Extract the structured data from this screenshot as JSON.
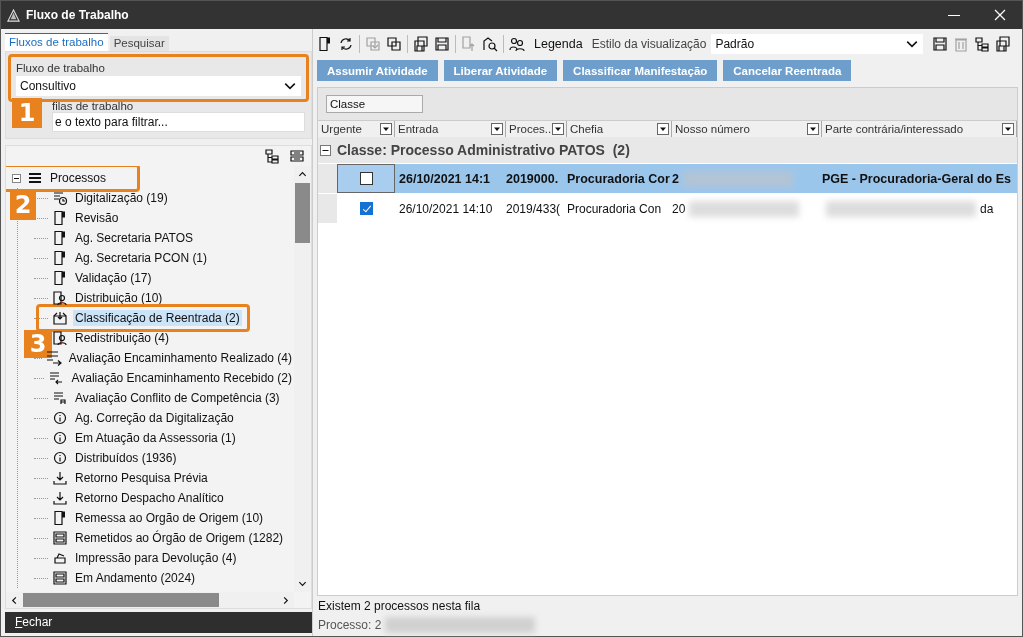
{
  "window": {
    "title": "Fluxo de Trabalho"
  },
  "left_tabs": [
    {
      "label": "Fluxos de trabalho",
      "selected": true
    },
    {
      "label": "Pesquisar",
      "selected": false
    }
  ],
  "workflow": {
    "label": "Fluxo de trabalho",
    "value": "Consultivo"
  },
  "queue_filter": {
    "label": "filas de trabalho",
    "value": "e o texto para filtrar..."
  },
  "tree": [
    {
      "label": "Processos",
      "kind": "stack",
      "expanded": true,
      "selected": false,
      "children": [
        {
          "label": "Digitalização (19)",
          "kind": "clock",
          "selected": false
        },
        {
          "label": "Revisão",
          "kind": "doc",
          "selected": false
        },
        {
          "label": "Ag. Secretaria PATOS",
          "kind": "doc",
          "selected": false
        },
        {
          "label": "Ag. Secretaria PCON (1)",
          "kind": "doc",
          "selected": false
        },
        {
          "label": "Validação (17)",
          "kind": "doc",
          "selected": false
        },
        {
          "label": "Distribuição (10)",
          "kind": "person",
          "selected": false
        },
        {
          "label": "Classificação de Reentrada (2)",
          "kind": "inbox",
          "selected": true
        },
        {
          "label": "Redistribuição (4)",
          "kind": "person",
          "selected": false
        },
        {
          "label": "Avaliação Encaminhamento Realizado (4)",
          "kind": "list-out",
          "selected": false
        },
        {
          "label": "Avaliação Encaminhamento Recebido (2)",
          "kind": "list-in",
          "selected": false
        },
        {
          "label": "Avaliação Conflito de Competência (3)",
          "kind": "list-a",
          "selected": false
        },
        {
          "label": "Ag. Correção da Digitalização",
          "kind": "info",
          "selected": false
        },
        {
          "label": "Em Atuação da Assessoria (1)",
          "kind": "info",
          "selected": false
        },
        {
          "label": "Distribuídos (1936)",
          "kind": "info",
          "selected": false
        },
        {
          "label": "Retorno Pesquisa Prévia",
          "kind": "download",
          "selected": false
        },
        {
          "label": "Retorno Despacho Analítico",
          "kind": "download",
          "selected": false
        },
        {
          "label": "Remessa ao Orgão de Origem (10)",
          "kind": "doc",
          "selected": false
        },
        {
          "label": "Remetidos ao Órgão de Origem (1282)",
          "kind": "cabinet",
          "selected": false
        },
        {
          "label": "Impressão para Devolução (4)",
          "kind": "tray",
          "selected": false
        },
        {
          "label": "Em Andamento (2024)",
          "kind": "cabinet",
          "selected": false
        }
      ]
    }
  ],
  "close_button": "Fechar",
  "toolbar": [
    {
      "kind": "doc",
      "disabled": false
    },
    {
      "kind": "refresh",
      "disabled": false
    },
    {
      "kind": "sep"
    },
    {
      "kind": "copy-check",
      "disabled": true
    },
    {
      "kind": "copy",
      "disabled": false
    },
    {
      "kind": "sep"
    },
    {
      "kind": "save-stack",
      "disabled": false
    },
    {
      "kind": "save",
      "disabled": false
    },
    {
      "kind": "sep"
    },
    {
      "kind": "doc-up",
      "disabled": true
    },
    {
      "kind": "search",
      "disabled": false
    },
    {
      "kind": "sep"
    },
    {
      "kind": "people",
      "disabled": false
    }
  ],
  "legend_button": "Legenda",
  "view_style": {
    "label": "Estilo da visualização",
    "value": "Padrão"
  },
  "view_tools": [
    {
      "kind": "save",
      "disabled": false
    },
    {
      "kind": "trash",
      "disabled": true
    },
    {
      "kind": "hierarchy",
      "disabled": false
    },
    {
      "kind": "save-stack",
      "disabled": false
    }
  ],
  "actions": [
    "Assumir Atividade",
    "Liberar Atividade",
    "Classificar Manifestação",
    "Cancelar Reentrada"
  ],
  "group_by": "Classe",
  "columns": [
    "Urgente",
    "Entrada",
    "Proces...",
    "Chefia",
    "Nosso número",
    "Parte contrária/interessado"
  ],
  "group": {
    "label": "Classe: Processo Administrativo PATOS  (2)",
    "expanded": true
  },
  "rows": [
    {
      "selected": true,
      "checked": false,
      "cells": [
        {
          "text": "26/10/2021 14:1"
        },
        {
          "text": "2019000."
        },
        {
          "text": "Procuradoria Cor"
        },
        {
          "text": "2",
          "blur_after": true
        },
        {
          "text": "PGE - Procuradoria-Geral do Es"
        }
      ]
    },
    {
      "selected": false,
      "checked": true,
      "cells": [
        {
          "text": "26/10/2021 14:10"
        },
        {
          "text": "2019/433("
        },
        {
          "text": "Procuradoria Con"
        },
        {
          "text": "20",
          "blur_after": true
        },
        {
          "text": "da",
          "blur_before": true
        }
      ]
    }
  ],
  "status": "Existem 2 processos nesta fila",
  "detail": {
    "text": "Processo: 2",
    "blur_after": true
  },
  "callouts": [
    {
      "number": "1",
      "kind": "workflow"
    },
    {
      "number": "2",
      "kind": "tree-root"
    },
    {
      "number": "3",
      "kind": "tree-selected"
    }
  ]
}
